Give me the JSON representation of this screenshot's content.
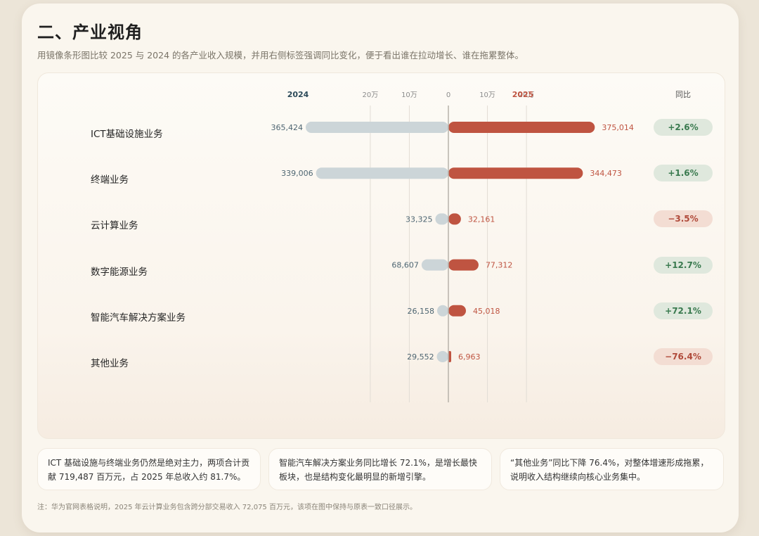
{
  "title": "二、产业视角",
  "subtitle": "用镜像条形图比较 2025 与 2024 的各产业收入规模，并用右侧标签强调同比变化，便于看出谁在拉动增长、谁在拖累整体。",
  "chart_data": {
    "type": "bar",
    "orientation": "horizontal-mirror",
    "left_series_label": "2024",
    "right_series_label": "2025",
    "yoy_header": "同比",
    "axis_ticks_left": [
      "20万",
      "10万"
    ],
    "axis_tick_zero": "0",
    "axis_ticks_right": [
      "10万",
      "20万"
    ],
    "axis_tick_values": [
      100000,
      200000
    ],
    "axis_max": 360000,
    "gridlines": true,
    "categories": [
      "ICT基础设施业务",
      "终端业务",
      "云计算业务",
      "数字能源业务",
      "智能汽车解决方案业务",
      "其他业务"
    ],
    "series": [
      {
        "name": "2024",
        "values": [
          365424,
          339006,
          33325,
          68607,
          26158,
          29552
        ],
        "labels": [
          "365,424",
          "339,006",
          "33,325",
          "68,607",
          "26,158",
          "29,552"
        ]
      },
      {
        "name": "2025",
        "values": [
          375014,
          344473,
          32161,
          77312,
          45018,
          6963
        ],
        "labels": [
          "375,014",
          "344,473",
          "32,161",
          "77,312",
          "45,018",
          "6,963"
        ]
      }
    ],
    "yoy": [
      "+2.6%",
      "+1.6%",
      "−3.5%",
      "+12.7%",
      "+72.1%",
      "−76.4%"
    ],
    "yoy_direction": [
      "up",
      "up",
      "down",
      "up",
      "up",
      "down"
    ]
  },
  "colors": {
    "bar_2024": "#ccd5d8",
    "bar_2025": "#bf5441",
    "label_2024": "#4e6672",
    "label_2025": "#bf5441",
    "series_label_2024": "#2c4a5a"
  },
  "notes": [
    "ICT 基础设施与终端业务仍然是绝对主力，两项合计贡献 719,487 百万元，占 2025 年总收入约 81.7%。",
    "智能汽车解决方案业务同比增长 72.1%，是增长最快板块，也是结构变化最明显的新增引擎。",
    "“其他业务”同比下降 76.4%，对整体增速形成拖累，说明收入结构继续向核心业务集中。"
  ],
  "footnote": "注：华为官网表格说明，2025 年云计算业务包含跨分部交易收入 72,075 百万元，该项在图中保持与原表一致口径展示。"
}
